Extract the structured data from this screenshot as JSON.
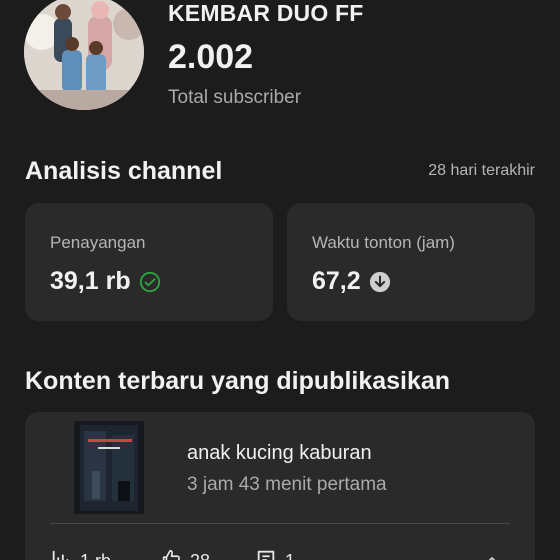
{
  "channel": {
    "name": "KEMBAR DUO FF",
    "subscriber_count": "2.002",
    "subscriber_label": "Total subscriber"
  },
  "analytics": {
    "title": "Analisis channel",
    "period": "28 hari terakhir",
    "cards": [
      {
        "label": "Penayangan",
        "value": "39,1 rb",
        "icon": "check-circle-icon",
        "icon_color": "#2ba640"
      },
      {
        "label": "Waktu tonton (jam)",
        "value": "67,2",
        "icon": "arrow-down-circle-icon",
        "icon_color": "#cfcfcf"
      }
    ]
  },
  "recent": {
    "title": "Konten terbaru yang dipublikasikan",
    "video": {
      "title": "anak kucing kaburan",
      "time": "3 jam 43 menit pertama"
    },
    "metrics": {
      "views": "1 rb",
      "likes": "28",
      "comments": "1"
    }
  },
  "colors": {
    "background": "#1c1c1c",
    "card": "#2a2a2a",
    "text_primary": "#f1f1f1",
    "text_secondary": "#aaaaaa"
  }
}
